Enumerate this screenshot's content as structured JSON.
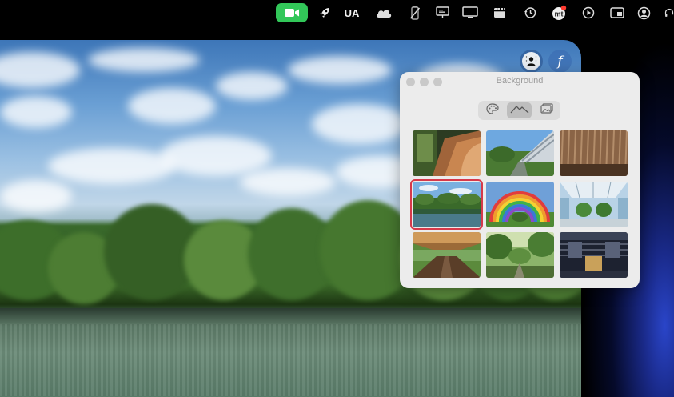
{
  "menubar": {
    "items": [
      {
        "icon": "video-camera-icon"
      },
      {
        "icon": "rocket-icon"
      },
      {
        "label": "UA"
      },
      {
        "icon": "cloud-icon"
      },
      {
        "icon": "battery-slash-icon"
      },
      {
        "icon": "monitor-presentation-icon"
      },
      {
        "icon": "display-icon"
      },
      {
        "icon": "clapper-icon"
      },
      {
        "icon": "time-machine-icon"
      },
      {
        "icon": "app-badge-icon"
      },
      {
        "icon": "play-circle-icon"
      },
      {
        "icon": "cast-screen-icon"
      },
      {
        "icon": "user-circle-icon"
      },
      {
        "icon": "headphones-icon"
      }
    ]
  },
  "video": {
    "overlay_buttons": [
      {
        "icon": "background-person-icon"
      },
      {
        "label": "f",
        "icon": "effects-icon"
      }
    ]
  },
  "panel": {
    "title": "Background",
    "segments": [
      {
        "icon": "palette-icon",
        "active": false
      },
      {
        "icon": "landscape-icon",
        "active": true
      },
      {
        "icon": "photos-icon",
        "active": false
      }
    ],
    "thumbnails": [
      {
        "name": "wood-staircase",
        "selected": false
      },
      {
        "name": "curved-building",
        "selected": false
      },
      {
        "name": "wood-slats",
        "selected": false
      },
      {
        "name": "lake-trees",
        "selected": true
      },
      {
        "name": "rainbow-arch",
        "selected": false
      },
      {
        "name": "atrium-trees",
        "selected": false
      },
      {
        "name": "canopy-walkway",
        "selected": false
      },
      {
        "name": "forest-garden",
        "selected": false
      },
      {
        "name": "glass-hall",
        "selected": false
      }
    ]
  },
  "colors": {
    "camera_active": "#32c759",
    "selection": "#d6394a",
    "panel_bg": "#ececec"
  }
}
